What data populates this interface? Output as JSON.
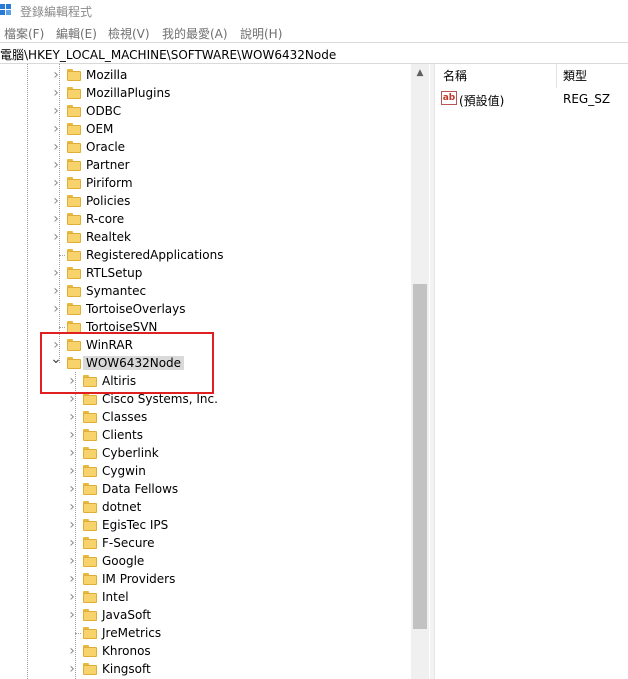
{
  "window": {
    "title": "登錄編輯程式"
  },
  "menu": [
    {
      "label": "檔案(F)"
    },
    {
      "label": "編輯(E)"
    },
    {
      "label": "檢視(V)"
    },
    {
      "label": "我的最愛(A)"
    },
    {
      "label": "說明(H)"
    }
  ],
  "address": {
    "path": "電腦\\HKEY_LOCAL_MACHINE\\SOFTWARE\\WOW6432Node"
  },
  "tree": {
    "level1": [
      {
        "label": "Mozilla",
        "expandable": true
      },
      {
        "label": "MozillaPlugins",
        "expandable": true
      },
      {
        "label": "ODBC",
        "expandable": true
      },
      {
        "label": "OEM",
        "expandable": true
      },
      {
        "label": "Oracle",
        "expandable": true
      },
      {
        "label": "Partner",
        "expandable": true
      },
      {
        "label": "Piriform",
        "expandable": true
      },
      {
        "label": "Policies",
        "expandable": true
      },
      {
        "label": "R-core",
        "expandable": true
      },
      {
        "label": "Realtek",
        "expandable": true
      },
      {
        "label": "RegisteredApplications",
        "expandable": false
      },
      {
        "label": "RTLSetup",
        "expandable": true
      },
      {
        "label": "Symantec",
        "expandable": true
      },
      {
        "label": "TortoiseOverlays",
        "expandable": true
      },
      {
        "label": "TortoiseSVN",
        "expandable": false
      },
      {
        "label": "WinRAR",
        "expandable": true
      },
      {
        "label": "WOW6432Node",
        "expandable": true,
        "expanded": true,
        "selected": true
      }
    ],
    "level2": [
      {
        "label": "Altiris",
        "expandable": true
      },
      {
        "label": "Cisco Systems, Inc.",
        "expandable": true
      },
      {
        "label": "Classes",
        "expandable": true
      },
      {
        "label": "Clients",
        "expandable": true
      },
      {
        "label": "Cyberlink",
        "expandable": true
      },
      {
        "label": "Cygwin",
        "expandable": true
      },
      {
        "label": "Data Fellows",
        "expandable": true
      },
      {
        "label": "dotnet",
        "expandable": true
      },
      {
        "label": "EgisTec IPS",
        "expandable": true
      },
      {
        "label": "F-Secure",
        "expandable": true
      },
      {
        "label": "Google",
        "expandable": true
      },
      {
        "label": "IM Providers",
        "expandable": true
      },
      {
        "label": "Intel",
        "expandable": true
      },
      {
        "label": "JavaSoft",
        "expandable": true
      },
      {
        "label": "JreMetrics",
        "expandable": false
      },
      {
        "label": "Khronos",
        "expandable": true
      },
      {
        "label": "Kingsoft",
        "expandable": true
      }
    ]
  },
  "list": {
    "headers": {
      "name": "名稱",
      "type": "類型"
    },
    "rows": [
      {
        "icon": "string-value-icon",
        "icon_text": "ab",
        "name": "(預設值)",
        "type": "REG_SZ"
      }
    ]
  },
  "colors": {
    "highlight": "#e02020",
    "folder": "#f8d26a",
    "selection": "#d9d9d9"
  }
}
